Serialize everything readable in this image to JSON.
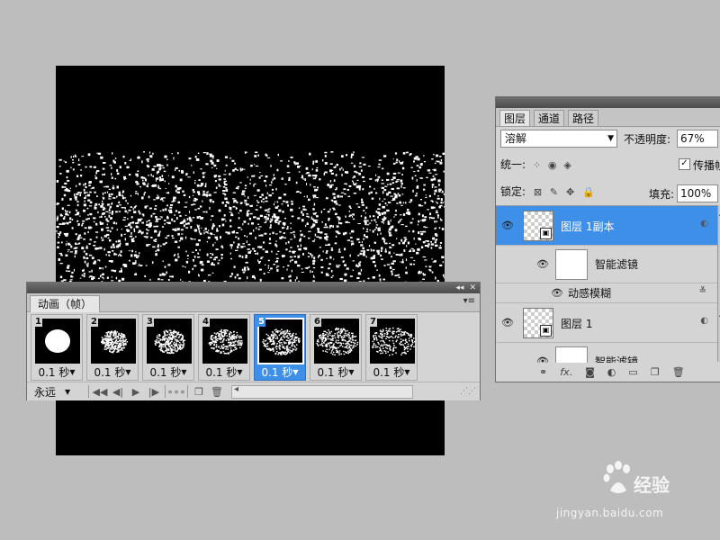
{
  "animation_panel": {
    "tab_label": "动画（帧）",
    "collapse_glyph": "◂◂",
    "close_glyph": "✕",
    "menu_glyph": "▾≡",
    "frames": [
      {
        "number": "1",
        "delay": "0.1 秒",
        "density": 0.1
      },
      {
        "number": "2",
        "delay": "0.1 秒",
        "density": 0.25
      },
      {
        "number": "3",
        "delay": "0.1 秒",
        "density": 0.4
      },
      {
        "number": "4",
        "delay": "0.1 秒",
        "density": 0.55
      },
      {
        "number": "5",
        "delay": "0.1 秒",
        "density": 0.7
      },
      {
        "number": "6",
        "delay": "0.1 秒",
        "density": 0.85
      },
      {
        "number": "7",
        "delay": "0.1 秒",
        "density": 1.0
      }
    ],
    "selected_frame": 5,
    "loop_option": "永远",
    "controls": {
      "first": "◀◀",
      "prev": "◀|",
      "play": "▶",
      "next": "|▶",
      "tween": "∘∘∘",
      "duplicate": "❐",
      "delete": "🗑"
    }
  },
  "layers_panel": {
    "tabs": [
      "图层",
      "通道",
      "路径"
    ],
    "active_tab": 0,
    "blend_mode": "溶解",
    "opacity_label": "不透明度:",
    "opacity_value": "67%",
    "unify_label": "统一:",
    "propagate_label": "传播帧",
    "lock_label": "锁定:",
    "fill_label": "填充:",
    "fill_value": "100%",
    "layers": [
      {
        "name": "图层 1副本",
        "smart_filter_label": "智能滤镜",
        "filter": "动感模糊"
      },
      {
        "name": "图层 1",
        "smart_filter_label": "智能滤镜"
      }
    ]
  },
  "watermark": {
    "logo": "Bai du",
    "brand": "经验",
    "url": "jingyan.baidu.com"
  }
}
